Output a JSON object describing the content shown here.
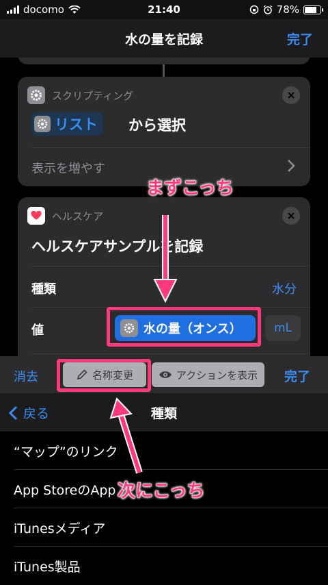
{
  "status_bar": {
    "carrier": "docomo",
    "time": "21:40",
    "battery": "78%",
    "battery_level": 0.78
  },
  "nav": {
    "title": "水の量を記録",
    "done": "完了"
  },
  "scripting_action": {
    "app_label": "スクリプティング",
    "token_label": "リスト",
    "suffix": "から選択",
    "show_more": "表示を増やす"
  },
  "health_action": {
    "app_label": "ヘルスケア",
    "title": "ヘルスケアサンプルを記録",
    "type_label": "種類",
    "type_value": "水分",
    "value_label": "値",
    "value_token": "水の量（オンス）",
    "unit": "mL"
  },
  "toolbar": {
    "clear": "消去",
    "rename": "名称変更",
    "show_action": "アクションを表示",
    "done": "完了"
  },
  "picker": {
    "back": "戻る",
    "title": "種類",
    "items": [
      "“マップ”のリンク",
      "App StoreのApp",
      "iTunesメディア",
      "iTunes製品"
    ]
  },
  "annotations": {
    "first": "まずこっち",
    "second": "次にこっち"
  },
  "colors": {
    "accent": "#3a8cf0",
    "highlight": "#ff3a7a"
  }
}
